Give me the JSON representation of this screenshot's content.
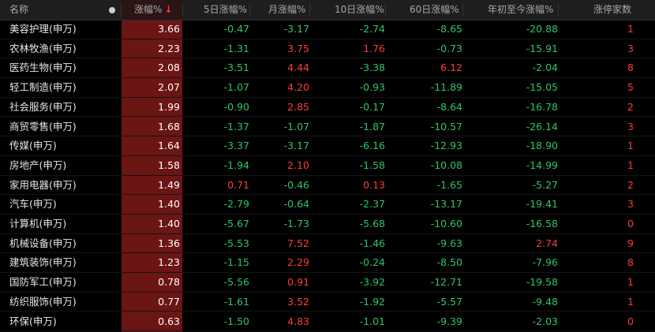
{
  "header": {
    "name": "名称",
    "dot": "●",
    "col1": "涨幅%",
    "col1_sort": "↓",
    "col2": "5日涨幅%",
    "col3": "月涨幅%",
    "col4": "10日涨幅%",
    "col5": "60日涨幅%",
    "col6": "年初至今涨幅%",
    "col7": "涨停家数"
  },
  "colors": {
    "up": "#ff3b3b",
    "down": "#2ec46b",
    "sorted_column_bg": "#6b1515",
    "background": "#000000"
  },
  "rows": [
    {
      "name": "美容护理(申万)",
      "chg": "3.66",
      "d5": "-0.47",
      "m": "-3.17",
      "d10": "-2.74",
      "d60": "-8.65",
      "ytd": "-20.88",
      "limit": "1"
    },
    {
      "name": "农林牧渔(申万)",
      "chg": "2.23",
      "d5": "-1.31",
      "m": "3.75",
      "d10": "1.76",
      "d60": "-0.73",
      "ytd": "-15.91",
      "limit": "3"
    },
    {
      "name": "医药生物(申万)",
      "chg": "2.08",
      "d5": "-3.51",
      "m": "4.44",
      "d10": "-3.38",
      "d60": "6.12",
      "ytd": "-2.04",
      "limit": "8"
    },
    {
      "name": "轻工制造(申万)",
      "chg": "2.07",
      "d5": "-1.07",
      "m": "4.20",
      "d10": "-0.93",
      "d60": "-11.89",
      "ytd": "-15.05",
      "limit": "5"
    },
    {
      "name": "社会服务(申万)",
      "chg": "1.99",
      "d5": "-0.90",
      "m": "2.85",
      "d10": "-0.17",
      "d60": "-8.64",
      "ytd": "-16.78",
      "limit": "2"
    },
    {
      "name": "商贸零售(申万)",
      "chg": "1.68",
      "d5": "-1.37",
      "m": "-1.07",
      "d10": "-1.87",
      "d60": "-10.57",
      "ytd": "-26.14",
      "limit": "3"
    },
    {
      "name": "传媒(申万)",
      "chg": "1.64",
      "d5": "-3.37",
      "m": "-3.17",
      "d10": "-6.16",
      "d60": "-12.93",
      "ytd": "-18.90",
      "limit": "1"
    },
    {
      "name": "房地产(申万)",
      "chg": "1.58",
      "d5": "-1.94",
      "m": "2.10",
      "d10": "-1.58",
      "d60": "-10.08",
      "ytd": "-14.99",
      "limit": "1"
    },
    {
      "name": "家用电器(申万)",
      "chg": "1.49",
      "d5": "0.71",
      "m": "-0.46",
      "d10": "0.13",
      "d60": "-1.65",
      "ytd": "-5.27",
      "limit": "2"
    },
    {
      "name": "汽车(申万)",
      "chg": "1.40",
      "d5": "-2.79",
      "m": "-0.64",
      "d10": "-2.37",
      "d60": "-13.17",
      "ytd": "-19.41",
      "limit": "3"
    },
    {
      "name": "计算机(申万)",
      "chg": "1.40",
      "d5": "-5.67",
      "m": "-1.73",
      "d10": "-5.68",
      "d60": "-10.60",
      "ytd": "-16.58",
      "limit": "0"
    },
    {
      "name": "机械设备(申万)",
      "chg": "1.36",
      "d5": "-5.53",
      "m": "7.52",
      "d10": "-1.46",
      "d60": "-9.63",
      "ytd": "2.74",
      "limit": "9"
    },
    {
      "name": "建筑装饰(申万)",
      "chg": "1.23",
      "d5": "-1.15",
      "m": "2.29",
      "d10": "-0.24",
      "d60": "-8.50",
      "ytd": "-7.96",
      "limit": "8"
    },
    {
      "name": "国防军工(申万)",
      "chg": "0.78",
      "d5": "-5.56",
      "m": "0.91",
      "d10": "-3.92",
      "d60": "-12.71",
      "ytd": "-19.58",
      "limit": "1"
    },
    {
      "name": "纺织服饰(申万)",
      "chg": "0.77",
      "d5": "-1.61",
      "m": "3.52",
      "d10": "-1.92",
      "d60": "-5.57",
      "ytd": "-9.48",
      "limit": "1"
    },
    {
      "name": "环保(申万)",
      "chg": "0.63",
      "d5": "-1.50",
      "m": "4.83",
      "d10": "-1.01",
      "d60": "-9.39",
      "ytd": "-2.03",
      "limit": "0"
    }
  ]
}
